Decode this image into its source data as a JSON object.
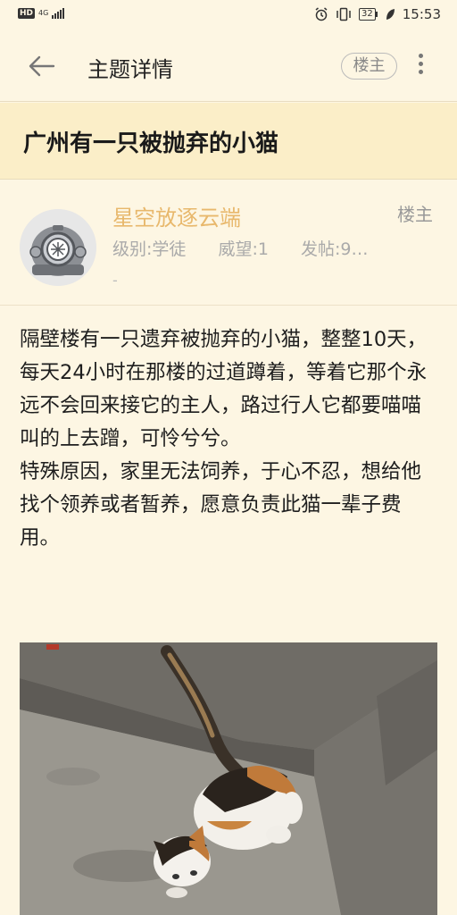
{
  "status_bar": {
    "hd": "HD",
    "network": "4G",
    "battery": "32",
    "time": "15:53"
  },
  "app_bar": {
    "title": "主题详情",
    "owner_filter": "楼主"
  },
  "thread": {
    "title": "广州有一只被抛弃的小猫"
  },
  "author": {
    "name": "星空放逐云端",
    "tag": "楼主",
    "level": "级别:学徒",
    "prestige": "威望:1",
    "posts": "发帖:9…",
    "extra": "-"
  },
  "post": {
    "paragraph_1": "隔壁楼有一只遗弃被抛弃的小猫，整整10天，每天24小时在那楼的过道蹲着，等着它那个永远不会回来接它的主人，路过行人它都要喵喵叫的上去蹭，可怜兮兮。",
    "paragraph_2": "特殊原因，家里无法饲养，于心不忍，想给他找个领养或者暂养，愿意负责此猫一辈子费用。"
  },
  "icons": {
    "back": "arrow-left-icon",
    "more": "more-vertical-icon",
    "avatar": "diving-helmet-avatar"
  }
}
